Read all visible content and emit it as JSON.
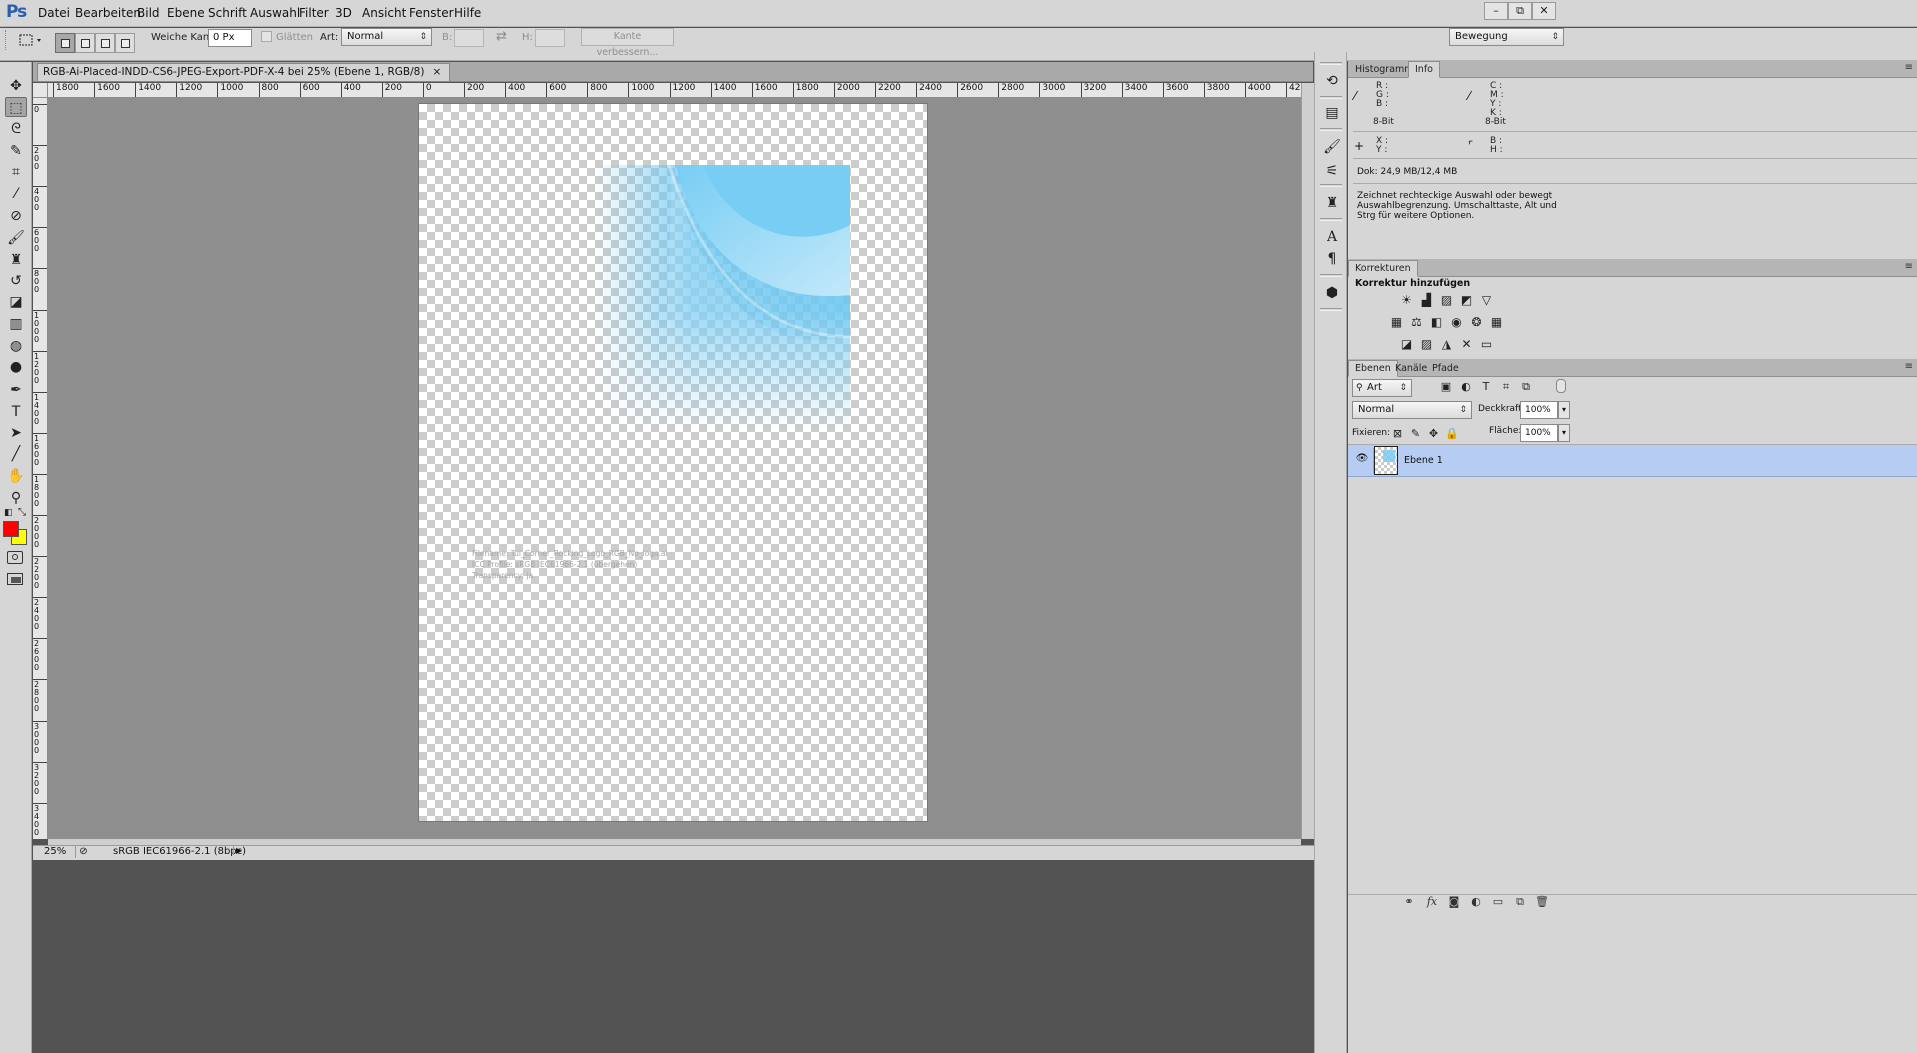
{
  "app": {
    "logo": "Ps"
  },
  "menu": [
    "Datei",
    "Bearbeiten",
    "Bild",
    "Ebene",
    "Schrift",
    "Auswahl",
    "Filter",
    "3D",
    "Ansicht",
    "Fenster",
    "Hilfe"
  ],
  "window_controls": {
    "minimize": "–",
    "restore": "⧉",
    "close": "✕"
  },
  "options": {
    "feather_label": "Weiche Kante:",
    "feather_value": "0 Px",
    "antialias_label": "Glätten",
    "style_label": "Art:",
    "style_value": "Normal",
    "width_label": "B:",
    "height_label": "H:",
    "swap_icon": "⇄",
    "refine_edge_label": "Kante verbessern...",
    "workspace_value": "Bewegung"
  },
  "tools": [
    {
      "name": "move-tool-icon",
      "glyph": "✥"
    },
    {
      "name": "marquee-tool-icon",
      "glyph": "⬚",
      "active": true
    },
    {
      "name": "lasso-tool-icon",
      "glyph": "ᘓ"
    },
    {
      "name": "quick-selection-tool-icon",
      "glyph": "✎"
    },
    {
      "name": "crop-tool-icon",
      "glyph": "⌗"
    },
    {
      "name": "eyedropper-tool-icon",
      "glyph": "⁄"
    },
    {
      "name": "healing-brush-tool-icon",
      "glyph": "⊘"
    },
    {
      "name": "brush-tool-icon",
      "glyph": "🖌"
    },
    {
      "name": "clone-stamp-tool-icon",
      "glyph": "♜"
    },
    {
      "name": "history-brush-tool-icon",
      "glyph": "↺"
    },
    {
      "name": "eraser-tool-icon",
      "glyph": "◪"
    },
    {
      "name": "gradient-tool-icon",
      "glyph": "▥"
    },
    {
      "name": "blur-tool-icon",
      "glyph": "◍"
    },
    {
      "name": "dodge-tool-icon",
      "glyph": "●"
    },
    {
      "name": "pen-tool-icon",
      "glyph": "✒"
    },
    {
      "name": "type-tool-icon",
      "glyph": "T"
    },
    {
      "name": "path-selection-tool-icon",
      "glyph": "➤"
    },
    {
      "name": "line-tool-icon",
      "glyph": "╱"
    },
    {
      "name": "hand-tool-icon",
      "glyph": "✋"
    },
    {
      "name": "zoom-tool-icon",
      "glyph": "⚲"
    }
  ],
  "colors": {
    "foreground": "#ff0000",
    "background": "#ffff00",
    "art_blue": "#6fc8f2"
  },
  "document": {
    "tab_title": "RGB-Ai-Placed-INDD-CS6-JPEG-Export-PDF-X-4 bei 25% (Ebene 1, RGB/8)",
    "tab_close": "×",
    "text_line1": "Filename: Tui_Corner_Rocking_Logo_RGB_No_logo.ai",
    "text_line2": "ICC Profile: sRGB IEC61966-2.1 (übergehen)",
    "text_line3": "Transparency: ja"
  },
  "ruler": {
    "h_labels": [
      "1800",
      "1600",
      "1400",
      "1200",
      "1000",
      "800",
      "600",
      "400",
      "200",
      "0",
      "200",
      "400",
      "600",
      "800",
      "1000",
      "1200",
      "1400",
      "1600",
      "1800",
      "2000",
      "2200",
      "2400",
      "2600",
      "2800",
      "3000",
      "3200",
      "3400",
      "3600",
      "3800",
      "4000",
      "4200"
    ],
    "v_labels": [
      "0",
      "200",
      "400",
      "600",
      "800",
      "1000",
      "1200",
      "1400",
      "1600",
      "1800",
      "2000",
      "2200",
      "2400",
      "2600",
      "2800",
      "3000",
      "3200",
      "3400"
    ]
  },
  "status": {
    "zoom": "25%",
    "profile": "sRGB IEC61966-2.1 (8bpc)",
    "arrow": "▶"
  },
  "panels": {
    "histogram_tab": "Histogramm",
    "info_tab": "Info",
    "info_rgb": "R :\nG :\nB :",
    "info_cmyk": "C :\nM :\nY :\nK :",
    "bit_depth_left": "8-Bit",
    "bit_depth_right": "8-Bit",
    "info_xy": "X :\nY :",
    "info_bh": "B :\nH :",
    "doc_size": "Dok: 24,9 MB/12,4 MB",
    "hint": "Zeichnet rechteckige Auswahl oder bewegt Auswahlbegrenzung. Umschalttaste, Alt und Strg für weitere Optionen.",
    "adjustments_tab": "Korrekturen",
    "adjustments_title": "Korrektur hinzufügen",
    "layers_tab": "Ebenen",
    "channels_tab": "Kanäle",
    "paths_tab": "Pfade",
    "filter_kind": "Art",
    "blend_mode": "Normal",
    "opacity_label": "Deckkraft:",
    "opacity_value": "100%",
    "lock_label": "Fixieren:",
    "fill_label": "Fläche:",
    "fill_value": "100%",
    "layer_name": "Ebene 1",
    "eye_icon": "👁"
  }
}
